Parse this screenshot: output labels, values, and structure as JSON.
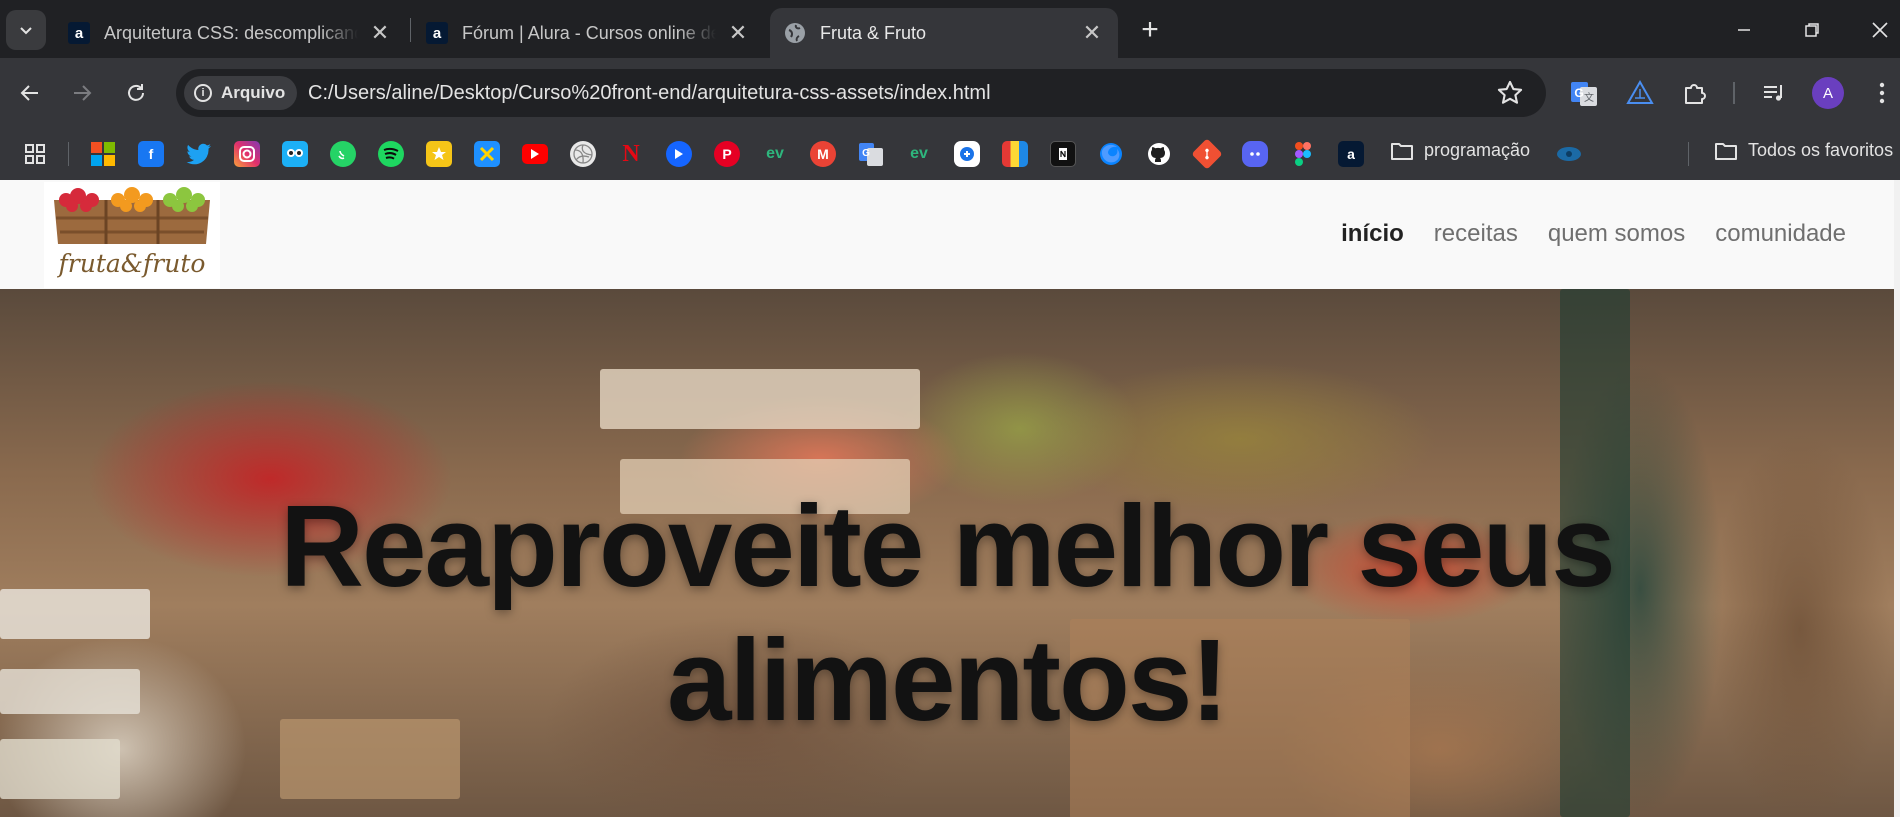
{
  "browser": {
    "tabs": [
      {
        "title": "Arquitetura CSS: descomplicando",
        "favicon": "alura-icon",
        "active": false
      },
      {
        "title": "Fórum | Alura - Cursos online de",
        "favicon": "alura-icon",
        "active": false
      },
      {
        "title": "Fruta & Fruto",
        "favicon": "globe-icon",
        "active": true
      }
    ],
    "address_bar": {
      "security_chip": "Arquivo",
      "url": "C:/Users/aline/Desktop/Curso%20front-end/arquitetura-css-assets/index.html"
    },
    "profile_initial": "A",
    "bookmarks": {
      "icons": [
        "apps-icon",
        "microsoft-icon",
        "facebook-icon",
        "twitter-icon",
        "instagram-icon",
        "duolingo-icon",
        "whatsapp-icon",
        "spotify-icon",
        "star-app-icon",
        "x-app-icon",
        "youtube-icon",
        "volleyball-icon",
        "netflix-icon",
        "play-icon",
        "pinterest-icon",
        "ev-icon",
        "gmail-icon",
        "google-translate-icon",
        "ev-icon",
        "shield-app-icon",
        "colors-app-icon",
        "notion-icon",
        "firefox-icon",
        "github-icon",
        "git-icon",
        "discord-icon",
        "figma-icon",
        "alura-icon",
        "eye-icon"
      ],
      "folder_programming": "programação",
      "folder_all": "Todos os favoritos"
    },
    "colors": {
      "frame": "#202124",
      "toolbar": "#35363a",
      "omnibox": "#202124",
      "accent_profile": "#6a3fbf"
    }
  },
  "site": {
    "logo_text": "fruta&fruto",
    "nav": [
      {
        "label": "início",
        "current": true
      },
      {
        "label": "receitas",
        "current": false
      },
      {
        "label": "quem somos",
        "current": false
      },
      {
        "label": "comunidade",
        "current": false
      }
    ],
    "hero_title_line1": "Reaproveite melhor seus",
    "hero_title_line2": "alimentos!"
  }
}
